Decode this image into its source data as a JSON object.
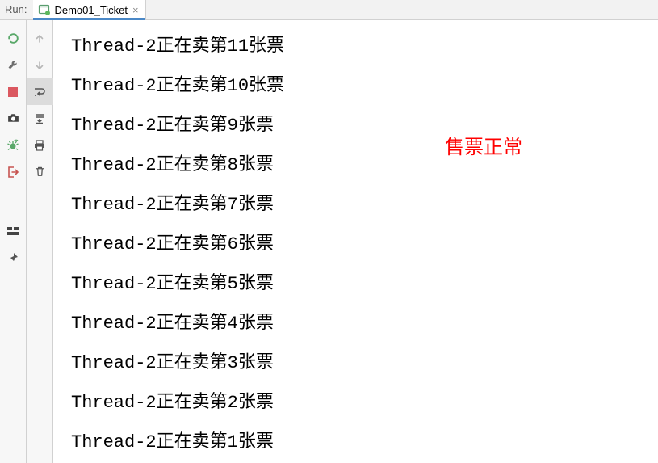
{
  "topbar": {
    "run_label": "Run:",
    "tab": {
      "title": "Demo01_Ticket",
      "close_glyph": "×"
    }
  },
  "left_toolbar": {
    "items": [
      {
        "name": "rerun-icon"
      },
      {
        "name": "wrench-icon"
      },
      {
        "name": "stop-icon"
      },
      {
        "name": "camera-icon"
      },
      {
        "name": "debug-rerun-icon"
      },
      {
        "name": "exit-icon"
      }
    ],
    "lower": [
      {
        "name": "layout-icon"
      },
      {
        "name": "pin-icon"
      }
    ]
  },
  "second_toolbar": {
    "items": [
      {
        "name": "up-arrow-icon"
      },
      {
        "name": "down-arrow-icon"
      },
      {
        "name": "soft-wrap-icon"
      },
      {
        "name": "scroll-end-icon"
      },
      {
        "name": "print-icon"
      },
      {
        "name": "trash-icon"
      }
    ]
  },
  "console": {
    "lines": [
      "Thread-2正在卖第11张票",
      "Thread-2正在卖第10张票",
      "Thread-2正在卖第9张票",
      "Thread-2正在卖第8张票",
      "Thread-2正在卖第7张票",
      "Thread-2正在卖第6张票",
      "Thread-2正在卖第5张票",
      "Thread-2正在卖第4张票",
      "Thread-2正在卖第3张票",
      "Thread-2正在卖第2张票",
      "Thread-2正在卖第1张票"
    ]
  },
  "annotation": {
    "text": "售票正常",
    "color": "#ff0000"
  }
}
